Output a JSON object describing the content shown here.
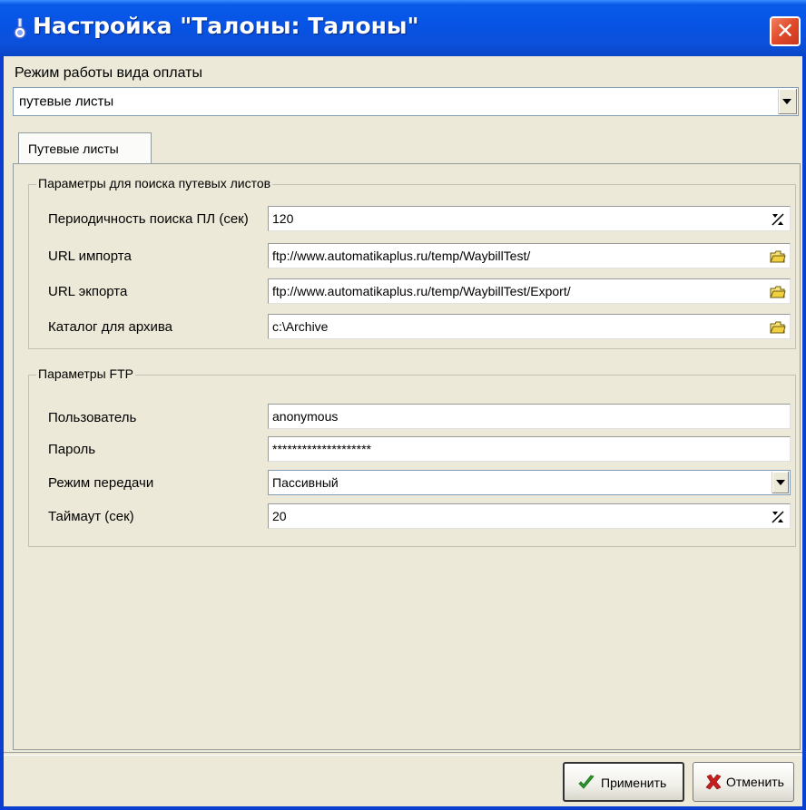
{
  "window": {
    "title": "Настройка \"Талоны: Талоны\"",
    "close_symbol": "✕"
  },
  "payment_mode": {
    "label": "Режим работы вида оплаты",
    "selected": "путевые листы"
  },
  "tabs": [
    {
      "label": "Путевые листы",
      "active": true
    }
  ],
  "search_params": {
    "title": "Параметры для поиска путевых листов",
    "fields": [
      {
        "label": "Периодичность поиска ПЛ (сек)",
        "value": "120",
        "icon": "spinner-icon"
      },
      {
        "label": "URL импорта",
        "value": "ftp://www.automatikaplus.ru/temp/WaybillTest/",
        "icon": "folder-open-icon"
      },
      {
        "label": "URL экпорта",
        "value": "ftp://www.automatikaplus.ru/temp/WaybillTest/Export/",
        "icon": "folder-open-icon"
      },
      {
        "label": "Каталог для архива",
        "value": "c:\\Archive",
        "icon": "folder-open-icon"
      }
    ]
  },
  "ftp_params": {
    "title": "Параметры FTP",
    "user_label": "Пользователь",
    "user_value": "anonymous",
    "password_label": "Пароль",
    "password_value": "********************",
    "transfer_label": "Режим передачи",
    "transfer_value": "Пассивный",
    "timeout_label": "Таймаут (сек)",
    "timeout_value": "20"
  },
  "buttons": {
    "apply": "Применить",
    "cancel": "Отменить"
  },
  "colors": {
    "titlebar": "#0754e6",
    "close": "#e04a2a",
    "apply_icon": "#2a9a2a",
    "cancel_icon": "#c81e1e",
    "background": "#ece9d8"
  }
}
